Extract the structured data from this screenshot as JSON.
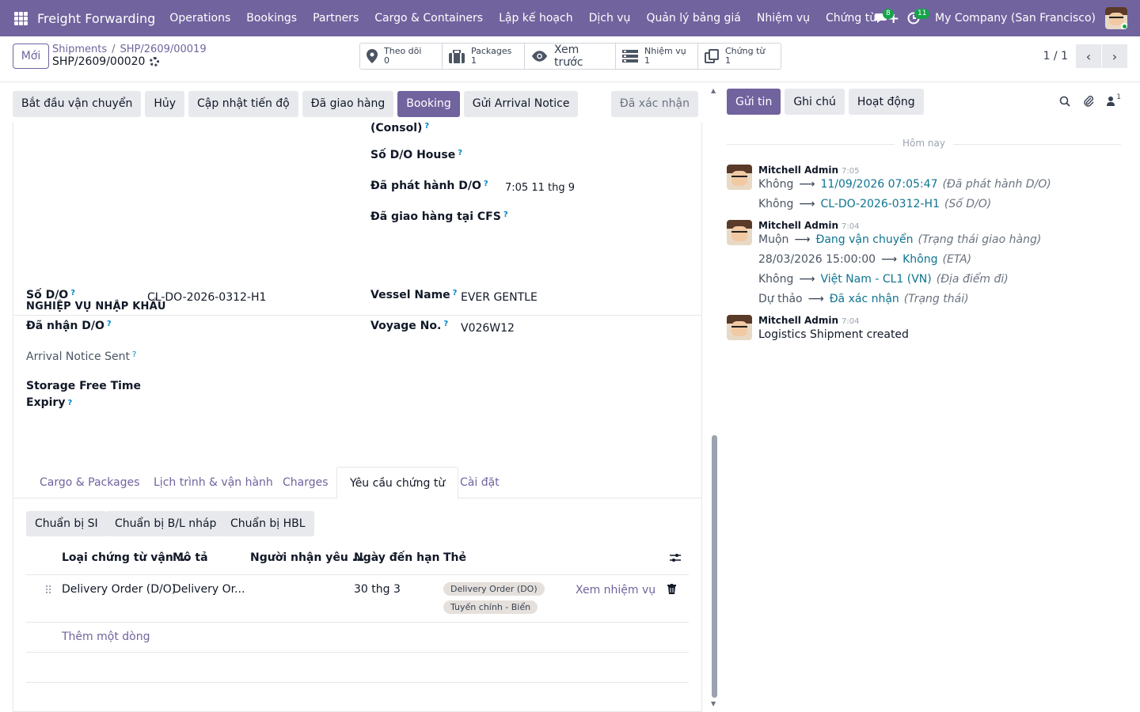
{
  "navbar": {
    "app_name": "Freight Forwarding",
    "menu": [
      "Operations",
      "Bookings",
      "Partners",
      "Cargo & Containers",
      "Lập kế hoạch",
      "Dịch vụ",
      "Quản lý bảng giá",
      "Nhiệm vụ",
      "Chứng từ"
    ],
    "messages_count": "8",
    "activities_count": "11",
    "company": "My Company (San Francisco)"
  },
  "control_panel": {
    "new_label": "Mới",
    "breadcrumb": [
      "Shipments",
      "SHP/2609/00019"
    ],
    "record_name": "SHP/2609/00020",
    "smart_buttons": [
      {
        "label": "Theo dõi",
        "value": "0"
      },
      {
        "label": "Packages",
        "value": "1"
      },
      {
        "label": "Xem trước",
        "value": ""
      },
      {
        "label": "Nhiệm vụ",
        "value": "1"
      },
      {
        "label": "Chứng từ",
        "value": "1"
      }
    ],
    "pager": "1 / 1"
  },
  "actions": [
    "Bắt đầu vận chuyển",
    "Hủy",
    "Cập nhật tiến độ",
    "Đã giao hàng",
    "Booking",
    "Gửi Arrival Notice"
  ],
  "status": "Đã xác nhận",
  "fields_top": {
    "consol_label": "(Consol)",
    "do_house_label": "Số D/O House",
    "do_issued_label": "Đã phát hành D/O",
    "do_issued_value": "7:05 11 thg 9",
    "cfs_label": "Đã giao hàng tại CFS"
  },
  "import_section": {
    "title": "NGHIỆP VỤ NHẬP KHẨU",
    "do_no_label": "Số D/O",
    "do_no_value": "CL-DO-2026-0312-H1",
    "do_received_label": "Đã nhận D/O",
    "arrival_sent_label": "Arrival Notice Sent",
    "storage_label_1": "Storage Free Time",
    "storage_label_2": "Expiry",
    "vessel_label": "Vessel Name",
    "vessel_value": "EVER GENTLE",
    "voyage_label": "Voyage No.",
    "voyage_value": "V026W12"
  },
  "tabs": [
    "Cargo & Packages",
    "Lịch trình & vận hành",
    "Charges",
    "Yêu cầu chứng từ",
    "Cài đặt"
  ],
  "doc_buttons": [
    "Chuẩn bị SI",
    "Chuẩn bị B/L nháp",
    "Chuẩn bị HBL"
  ],
  "table": {
    "headers": [
      "Loại chứng từ vận ...",
      "Mô tả",
      "Người nhận yêu ...",
      "Ngày đến hạn",
      "Thẻ"
    ],
    "row": {
      "type": "Delivery Order (D/O)",
      "desc": "Delivery Or...",
      "due": "30 thg 3",
      "tags": [
        "Delivery Order (DO)",
        "Tuyến chính - Biển"
      ],
      "link": "Xem nhiệm vụ"
    },
    "add_line": "Thêm một dòng"
  },
  "chatter": {
    "send_label": "Gửi tin",
    "note_label": "Ghi chú",
    "activity_label": "Hoạt động",
    "followers_count": "1",
    "today": "Hôm nay",
    "messages": [
      {
        "author": "Mitchell Admin",
        "time": "7:05",
        "changes": [
          {
            "old": "Không",
            "new": "11/09/2026 07:05:47",
            "field": "(Đã phát hành D/O)"
          },
          {
            "old": "Không",
            "new": "CL-DO-2026-0312-H1",
            "field": "(Số D/O)"
          }
        ]
      },
      {
        "author": "Mitchell Admin",
        "time": "7:04",
        "changes": [
          {
            "old": "Muộn",
            "new": "Đang vận chuyển",
            "field": "(Trạng thái giao hàng)"
          },
          {
            "old": "28/03/2026 15:00:00",
            "new": "Không",
            "field": "(ETA)"
          },
          {
            "old": "Không",
            "new": "Việt Nam - CL1 (VN)",
            "field": "(Địa điểm đi)"
          },
          {
            "old": "Dự thảo",
            "new": "Đã xác nhận",
            "field": "(Trạng thái)"
          }
        ]
      },
      {
        "author": "Mitchell Admin",
        "time": "7:04",
        "body": "Logistics Shipment created"
      }
    ]
  },
  "colors": {
    "brand": "#71639e",
    "link": "#0e7490",
    "help": "#0284c7"
  }
}
